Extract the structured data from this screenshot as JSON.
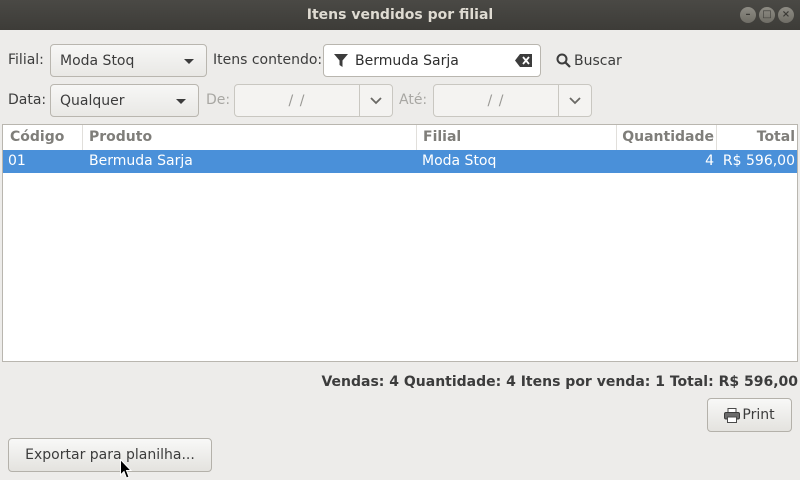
{
  "window": {
    "title": "Itens vendidos por filial"
  },
  "filters": {
    "branch_label": "Filial:",
    "branch_value": "Moda Stoq",
    "items_label": "Itens contendo:",
    "items_value": "Bermuda Sarja",
    "search_label": "Buscar",
    "date_label": "Data:",
    "date_value": "Qualquer",
    "from_label": "De:",
    "to_label": "Até:",
    "date_placeholder": "/   /"
  },
  "table": {
    "columns": [
      "Código",
      "Produto",
      "Filial",
      "Quantidade",
      "Total"
    ],
    "sort_column": "Código",
    "rows": [
      {
        "codigo": "01",
        "produto": "Bermuda Sarja",
        "filial": "Moda Stoq",
        "quantidade": "4",
        "total": "R$ 596,00"
      }
    ]
  },
  "summary": {
    "text": "Vendas: 4 Quantidade: 4 Itens por venda: 1 Total: R$ 596,00"
  },
  "buttons": {
    "print": "Print",
    "export": "Exportar para planilha..."
  },
  "icons": {
    "filter": "filter-icon",
    "clear": "clear-text-icon",
    "search": "search-icon",
    "print": "printer-icon",
    "sort": "sort-ascending-icon"
  }
}
